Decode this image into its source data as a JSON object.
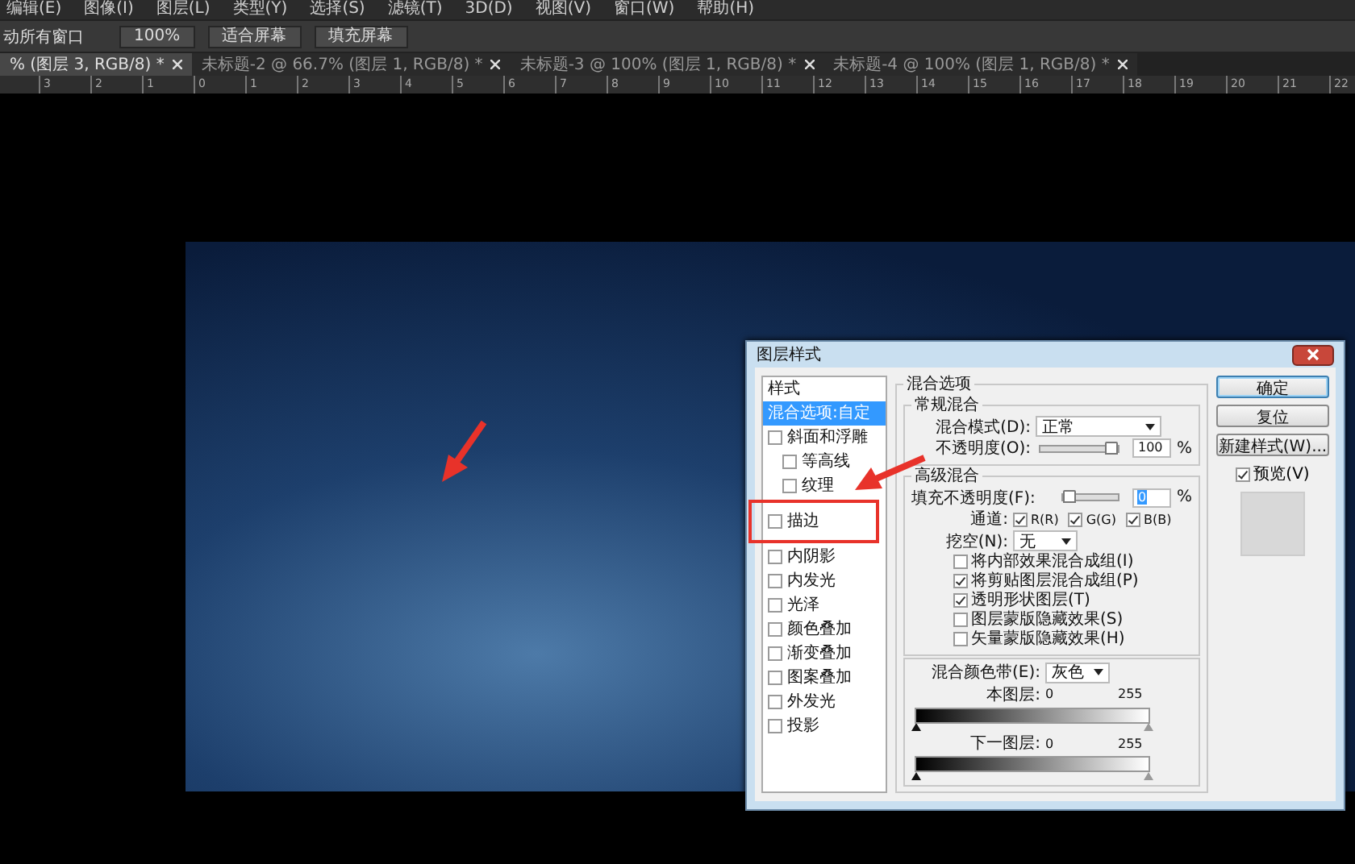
{
  "menu_bar": [
    "编辑(E)",
    "图像(I)",
    "图层(L)",
    "类型(Y)",
    "选择(S)",
    "滤镜(T)",
    "3D(D)",
    "视图(V)",
    "窗口(W)",
    "帮助(H)"
  ],
  "options_bar": {
    "label": "动所有窗口",
    "buttons": [
      "100%",
      "适合屏幕",
      "填充屏幕"
    ]
  },
  "document_tabs": [
    {
      "label": "% (图层 3, RGB/8) *",
      "selected": true
    },
    {
      "label": "未标题-2 @ 66.7% (图层 1, RGB/8) *",
      "selected": false
    },
    {
      "label": "未标题-3 @ 100% (图层 1, RGB/8) *",
      "selected": false
    },
    {
      "label": "未标题-4 @ 100% (图层 1, RGB/8) *",
      "selected": false
    }
  ],
  "ruler": [
    "3",
    "2",
    "1",
    "0",
    "1",
    "2",
    "3",
    "4",
    "5",
    "6",
    "7",
    "8",
    "9",
    "10",
    "11",
    "12",
    "13",
    "14",
    "15",
    "16",
    "17",
    "18",
    "19",
    "20",
    "21",
    "22"
  ],
  "dialog": {
    "title": "图层样式",
    "styles_header": "样式",
    "styles": [
      {
        "label": "混合选项:自定",
        "kind": "header",
        "selected": true
      },
      {
        "label": "斜面和浮雕",
        "kind": "check",
        "checked": false,
        "selected": false,
        "children": [
          {
            "label": "等高线",
            "kind": "check",
            "checked": false,
            "selected": false
          },
          {
            "label": "纹理",
            "kind": "check",
            "checked": false,
            "selected": false
          }
        ]
      },
      {
        "label": "描边",
        "kind": "check",
        "checked": false,
        "selected": false,
        "highlighted": true
      },
      {
        "label": "内阴影",
        "kind": "check",
        "checked": false,
        "selected": false
      },
      {
        "label": "内发光",
        "kind": "check",
        "checked": false,
        "selected": false
      },
      {
        "label": "光泽",
        "kind": "check",
        "checked": false,
        "selected": false
      },
      {
        "label": "颜色叠加",
        "kind": "check",
        "checked": false,
        "selected": false
      },
      {
        "label": "渐变叠加",
        "kind": "check",
        "checked": false,
        "selected": false
      },
      {
        "label": "图案叠加",
        "kind": "check",
        "checked": false,
        "selected": false
      },
      {
        "label": "外发光",
        "kind": "check",
        "checked": false,
        "selected": false
      },
      {
        "label": "投影",
        "kind": "check",
        "checked": false,
        "selected": false
      }
    ],
    "blending_title": "混合选项",
    "general": {
      "title": "常规混合",
      "mode_label": "混合模式(D):",
      "mode_value": "正常",
      "opacity_label": "不透明度(O):",
      "opacity": {
        "level": 1,
        "value": "100",
        "unit": "%"
      }
    },
    "advanced": {
      "title": "高级混合",
      "fill_label": "填充不透明度(F):",
      "fill": {
        "level": 0,
        "value": "0",
        "unit": "%"
      },
      "channels_label": "通道:",
      "channels": [
        {
          "label": "R(R)",
          "checked": true
        },
        {
          "label": "G(G)",
          "checked": true
        },
        {
          "label": "B(B)",
          "checked": true
        }
      ],
      "knockout_label": "挖空(N):",
      "knockout_value": "无",
      "options": [
        {
          "label": "将内部效果混合成组(I)",
          "checked": false
        },
        {
          "label": "将剪贴图层混合成组(P)",
          "checked": true
        },
        {
          "label": "透明形状图层(T)",
          "checked": true
        },
        {
          "label": "图层蒙版隐藏效果(S)",
          "checked": false
        },
        {
          "label": "矢量蒙版隐藏效果(H)",
          "checked": false
        }
      ]
    },
    "blend_if": {
      "label": "混合颜色带(E):",
      "value": "灰色",
      "bands": [
        {
          "label": "本图层:",
          "min": "0",
          "max": "255"
        },
        {
          "label": "下一图层:",
          "min": "0",
          "max": "255"
        }
      ]
    },
    "buttons": [
      "确定",
      "复位",
      "新建样式(W)..."
    ],
    "preview": {
      "label": "预览(V)",
      "checked": true
    }
  }
}
